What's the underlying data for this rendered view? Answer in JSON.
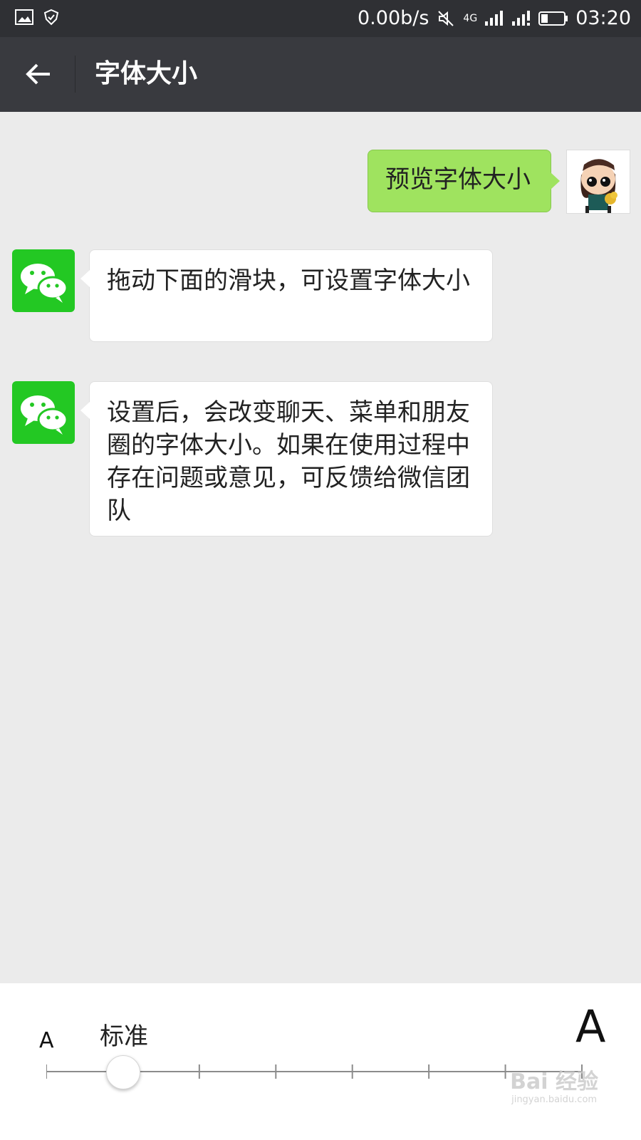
{
  "status_bar": {
    "speed": "0.00b/s",
    "network": "4G",
    "time": "03:20",
    "battery_percent": 30
  },
  "toolbar": {
    "title": "字体大小"
  },
  "chat": {
    "user_message": "预览字体大小",
    "messages": [
      {
        "text": "拖动下面的滑块，可设置字体大小"
      },
      {
        "text": "设置后，会改变聊天、菜单和朋友圈的字体大小。如果在使用过程中存在问题或意见，可反馈给微信团队"
      }
    ]
  },
  "font_panel": {
    "small_label": "A",
    "standard_label": "标准",
    "large_label": "A",
    "slider": {
      "steps": 8,
      "selected_index": 1
    }
  },
  "watermark": {
    "brand": "Bai 经验",
    "url": "jingyan.baidu.com"
  },
  "colors": {
    "status_bar": "#2f3034",
    "toolbar": "#393a3f",
    "user_bubble": "#9fe35f",
    "wechat_green": "#23c823",
    "chat_background": "#ebebeb"
  }
}
